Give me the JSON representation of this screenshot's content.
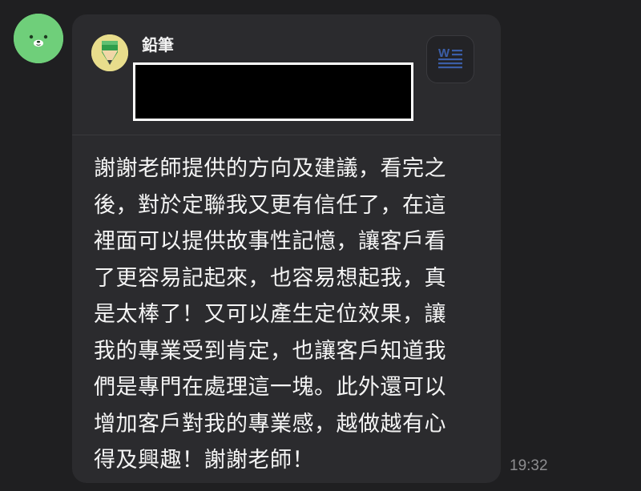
{
  "chat": {
    "sender_name": "鉛筆",
    "message_lines": [
      "謝謝老師提供的方向及建議，看完之",
      "後，對於定聯我又更有信任了，在這",
      "裡面可以提供故事性記憶，讓客戶看",
      "了更容易記起來，也容易想起我，真",
      "是太棒了！又可以產生定位效果，讓",
      "我的專業受到肯定，也讓客戶知道我",
      "們是專門在處理這一塊。此外還可以",
      "增加客戶對我的專業感，越做越有心",
      "得及興趣！謝謝老師！"
    ],
    "timestamp": "19:32"
  },
  "icons": {
    "contact_avatar": "green-bear-avatar-icon",
    "sender_avatar": "pencil-avatar-icon",
    "attachment": "word-document-icon"
  },
  "colors": {
    "background": "#1f1f21",
    "bubble": "#2b2b2e",
    "avatar_green": "#6fcf7a",
    "word_blue": "#3b5ea8"
  }
}
